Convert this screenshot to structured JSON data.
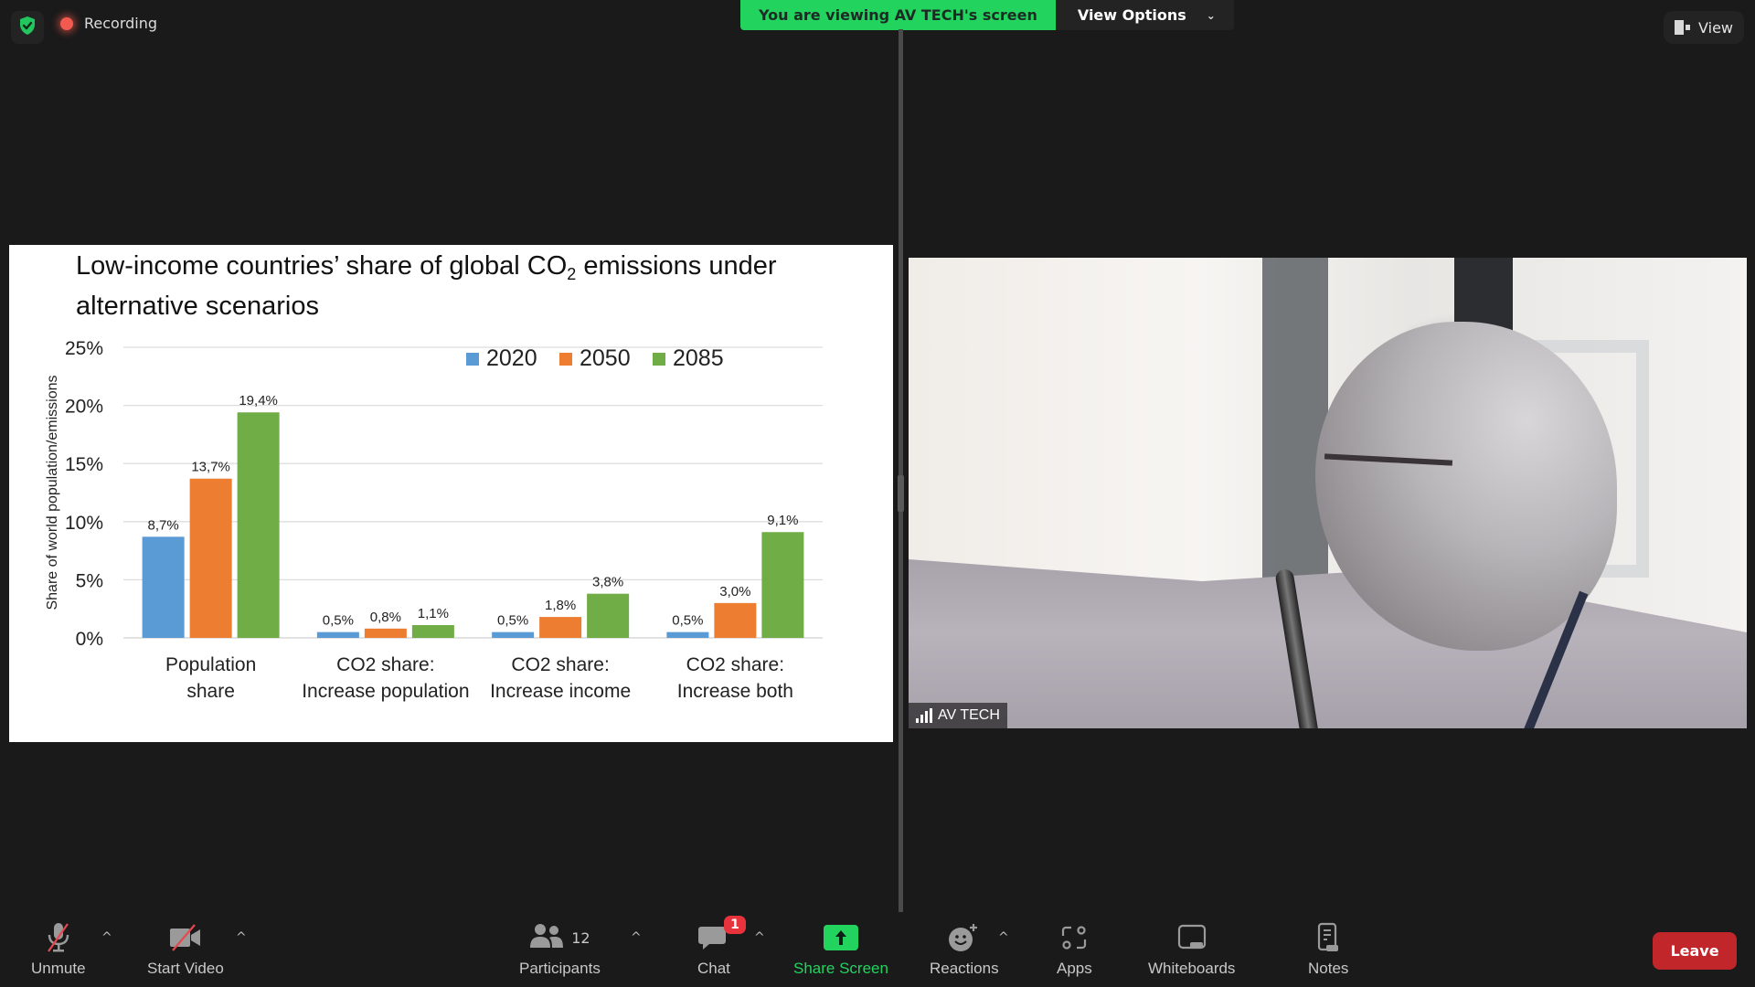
{
  "top_bar": {
    "security_icon": "shield-check-icon",
    "recording_label": "Recording",
    "banner_text": "You are viewing AV TECH's screen",
    "view_options_label": "View Options",
    "view_label": "View",
    "colors": {
      "banner_green": "#22d35e",
      "recording_red": "#f25a4f"
    }
  },
  "shared_screen": {
    "slide_title_line1_a": "Low-income countries’ share of global CO",
    "slide_title_sub": "2",
    "slide_title_line1_b": " emissions under",
    "slide_title_line2": "alternative scenarios"
  },
  "chart_data": {
    "type": "bar",
    "title": "Low-income countries’ share of global CO2 emissions under alternative scenarios",
    "xlabel": "",
    "ylabel": "Share of world population/emissions",
    "ylim": [
      0,
      25
    ],
    "yticks": [
      "0%",
      "5%",
      "10%",
      "15%",
      "20%",
      "25%"
    ],
    "grid": true,
    "legend_position": "top-right",
    "categories": [
      [
        "Population",
        "share"
      ],
      [
        "CO2 share:",
        "Increase population"
      ],
      [
        "CO2 share:",
        "Increase income"
      ],
      [
        "CO2 share:",
        "Increase both"
      ]
    ],
    "series": [
      {
        "name": "2020",
        "color": "#5b9bd5",
        "values": [
          8.7,
          0.5,
          0.5,
          0.5
        ],
        "labels": [
          "8,7%",
          "0,5%",
          "0,5%",
          "0,5%"
        ]
      },
      {
        "name": "2050",
        "color": "#ed7d31",
        "values": [
          13.7,
          0.8,
          1.8,
          3.0
        ],
        "labels": [
          "13,7%",
          "0,8%",
          "1,8%",
          "3,0%"
        ]
      },
      {
        "name": "2085",
        "color": "#70ad47",
        "values": [
          19.4,
          1.1,
          3.8,
          9.1
        ],
        "labels": [
          "19,4%",
          "1,1%",
          "3,8%",
          "9,1%"
        ]
      }
    ]
  },
  "video": {
    "participant_name": "AV TECH",
    "signal_icon": "signal-strength-icon"
  },
  "toolbar": {
    "unmute_label": "Unmute",
    "start_video_label": "Start Video",
    "participants_label": "Participants",
    "participants_count": "12",
    "chat_label": "Chat",
    "chat_badge": "1",
    "share_screen_label": "Share Screen",
    "reactions_label": "Reactions",
    "apps_label": "Apps",
    "whiteboards_label": "Whiteboards",
    "notes_label": "Notes",
    "leave_label": "Leave",
    "caret": "^",
    "colors": {
      "share_green": "#22d35e",
      "leave_red": "#c0262a",
      "badge_red": "#e8333d",
      "muted_slash": "#e8474f"
    }
  }
}
